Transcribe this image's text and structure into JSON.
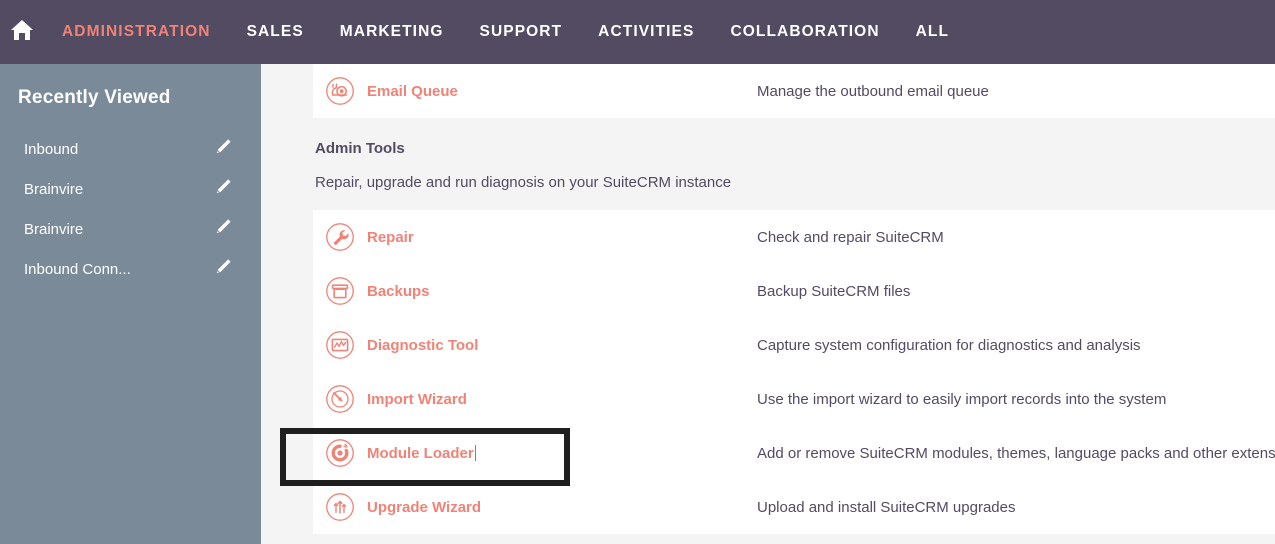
{
  "topnav": {
    "home_icon": "home-icon",
    "items": [
      {
        "label": "ADMINISTRATION",
        "active": true
      },
      {
        "label": "SALES",
        "active": false
      },
      {
        "label": "MARKETING",
        "active": false
      },
      {
        "label": "SUPPORT",
        "active": false
      },
      {
        "label": "ACTIVITIES",
        "active": false
      },
      {
        "label": "COLLABORATION",
        "active": false
      },
      {
        "label": "ALL",
        "active": false
      }
    ],
    "background_color": "#534b62",
    "active_color": "#f08377"
  },
  "sidebar": {
    "title": "Recently Viewed",
    "background_color": "#7b8a99",
    "collapse_icon": "triangle-left-icon",
    "items": [
      {
        "label": "Inbound",
        "edit_icon": "pencil-icon"
      },
      {
        "label": "Brainvire",
        "edit_icon": "pencil-icon"
      },
      {
        "label": "Brainvire",
        "edit_icon": "pencil-icon"
      },
      {
        "label": "Inbound Conn...",
        "edit_icon": "pencil-icon"
      }
    ]
  },
  "content": {
    "top_row": {
      "icon": "snail-icon",
      "name": "Email Queue",
      "description": "Manage the outbound email queue"
    },
    "section": {
      "title": "Admin Tools",
      "subtitle": "Repair, upgrade and run diagnosis on your SuiteCRM instance"
    },
    "rows": [
      {
        "icon": "wrench-icon",
        "name": "Repair",
        "description": "Check and repair SuiteCRM",
        "highlighted": false
      },
      {
        "icon": "backup-box-icon",
        "name": "Backups",
        "description": "Backup SuiteCRM files",
        "highlighted": false
      },
      {
        "icon": "chart-image-icon",
        "name": "Diagnostic Tool",
        "description": "Capture system configuration for diagnostics and analysis",
        "highlighted": false
      },
      {
        "icon": "import-arrow-icon",
        "name": "Import Wizard",
        "description": "Use the import wizard to easily import records into the system",
        "highlighted": false
      },
      {
        "icon": "module-loader-icon",
        "name": "Module Loader",
        "description": "Add or remove SuiteCRM modules, themes, language packs and other extensions",
        "highlighted": true
      },
      {
        "icon": "upgrade-arrows-icon",
        "name": "Upgrade Wizard",
        "description": "Upload and install SuiteCRM upgrades",
        "highlighted": false
      }
    ],
    "link_color": "#f08377",
    "text_color": "#534b62",
    "highlight_border_color": "#1f1f1f"
  }
}
